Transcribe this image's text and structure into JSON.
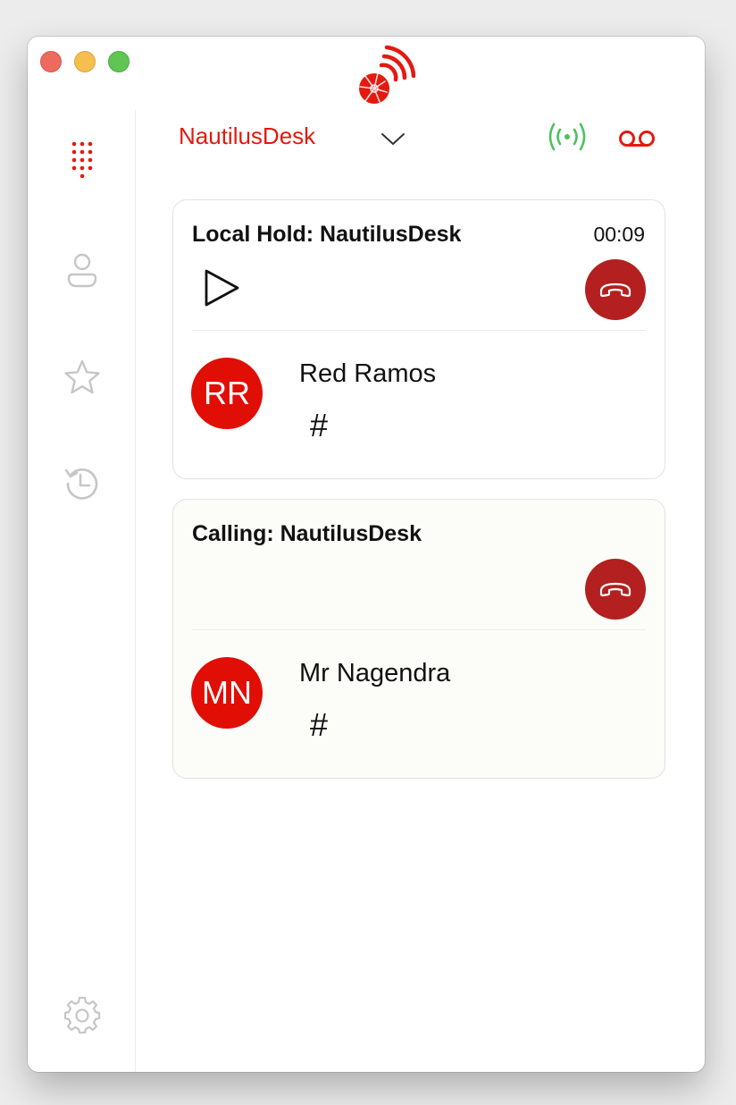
{
  "header": {
    "account_name": "NautilusDesk"
  },
  "sidebar": {
    "items": [
      {
        "name": "dialpad",
        "icon": "dialpad-icon",
        "active": true
      },
      {
        "name": "contacts",
        "icon": "contact-icon",
        "active": false
      },
      {
        "name": "favorites",
        "icon": "star-icon",
        "active": false
      },
      {
        "name": "history",
        "icon": "history-icon",
        "active": false
      },
      {
        "name": "settings",
        "icon": "gear-icon",
        "active": false
      }
    ]
  },
  "calls": [
    {
      "title": "Local Hold: NautilusDesk",
      "timer": "00:09",
      "initials": "RR",
      "contact_name": "Red Ramos",
      "keypad_label": "#"
    },
    {
      "title": "Calling: NautilusDesk",
      "initials": "MN",
      "contact_name": "Mr Nagendra",
      "keypad_label": "#"
    }
  ],
  "colors": {
    "brand_red": "#e4190f",
    "hangup_red": "#b3201f",
    "status_green": "#4cc15c",
    "icon_gray": "#c6c6c6"
  }
}
